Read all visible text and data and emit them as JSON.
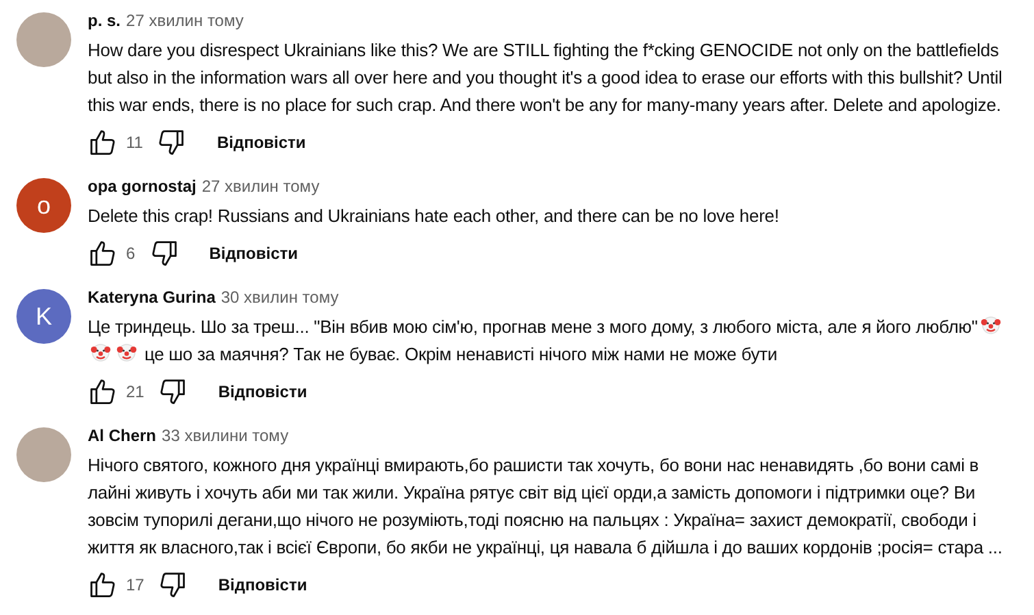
{
  "comments": [
    {
      "avatar": {
        "kind": "photo"
      },
      "author": "p. s.",
      "time": "27 хвилин тому",
      "body": [
        {
          "kind": "text",
          "text": "How dare you disrespect Ukrainians like this? We are STILL fighting the f*cking GENOCIDE not only on the battlefields but also in the information wars all over here and you thought it's a good idea to erase our efforts with this bullshit? Until this war ends, there is no place for such crap. And there won't be any for many-many years after. Delete and apologize."
        }
      ],
      "likes": "11",
      "reply": "Відповісти"
    },
    {
      "avatar": {
        "kind": "letter",
        "letter": "o",
        "color": "#c1401c"
      },
      "author": "opa gornostaj",
      "time": "27 хвилин тому",
      "body": [
        {
          "kind": "text",
          "text": "Delete this crap! Russians and Ukrainians hate each other, and there can be no love here!"
        }
      ],
      "likes": "6",
      "reply": "Відповісти"
    },
    {
      "avatar": {
        "kind": "letter",
        "letter": "K",
        "color": "#5c6bc0"
      },
      "author": "Kateryna Gurina",
      "time": "30 хвилин тому",
      "body": [
        {
          "kind": "text",
          "text": "Це триндець. Шо за треш... \"Він вбив мою сім'ю, прогнав мене з мого дому, з любого міста, але я його люблю\""
        },
        {
          "kind": "clown"
        },
        {
          "kind": "clown"
        },
        {
          "kind": "clown"
        },
        {
          "kind": "text",
          "text": " це шо за маячня? Так не буває. Окрім ненависті нічого між нами не може бути"
        }
      ],
      "likes": "21",
      "reply": "Відповісти"
    },
    {
      "avatar": {
        "kind": "photo"
      },
      "author": "Al Chern",
      "time": "33 хвилини тому",
      "body": [
        {
          "kind": "text",
          "text": "Нічого святого, кожного дня українці вмирають,бо рашисти так хочуть, бо вони нас ненавидять ,бо вони самі в лайні живуть і хочуть аби ми так жили. Україна рятує світ від цієї орди,а замість допомоги і підтримки оце? Ви зовсім тупорилі дегани,що нічого не розуміють,тоді поясню на пальцях : Україна= захист демократії, свободи і життя як власного,так і всієї Європи, бо якби не українці, ця навала б дійшла і до ваших кордонів ;росія= стара ..."
        }
      ],
      "likes": "17",
      "reply": "Відповісти"
    }
  ]
}
